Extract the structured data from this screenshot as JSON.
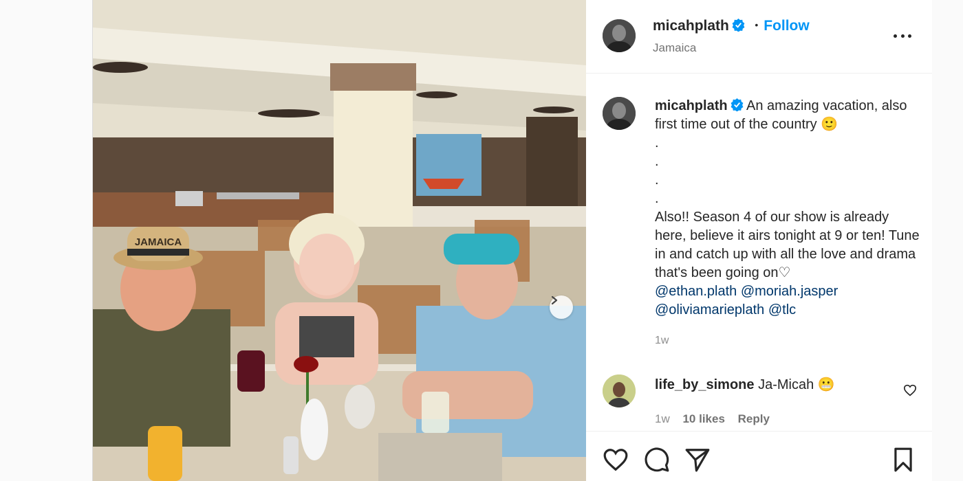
{
  "post": {
    "username": "micahplath",
    "follow_label": "Follow",
    "separator": "•",
    "location": "Jamaica"
  },
  "caption": {
    "username": "micahplath",
    "text_line1": "An amazing vacation, also first time out of the country",
    "emoji": "🙂",
    "dots": [
      ".",
      ".",
      ".",
      "."
    ],
    "text_line2": "Also!! Season 4 of our show is already here, believe it airs tonight at 9 or ten! Tune in and catch up with all the love and drama that's been going on",
    "heart_glyph": "♡",
    "mentions": [
      "@ethan.plath",
      "@moriah.jasper",
      "@oliviamarieplath",
      "@tlc"
    ],
    "time": "1w"
  },
  "comment": {
    "username": "life_by_simone",
    "text": "Ja-Micah",
    "emoji": "😬",
    "time": "1w",
    "likes": "10 likes",
    "reply_label": "Reply"
  },
  "media": {
    "hat_text": "JAMAICA"
  },
  "colors": {
    "link_blue": "#0095f6",
    "mention_blue": "#00376b",
    "verified_blue": "#0095f6"
  },
  "icons": [
    "verified-icon",
    "more-icon",
    "chevron-right-icon",
    "heart-icon",
    "comment-icon",
    "share-icon",
    "bookmark-icon",
    "comment-like-icon"
  ]
}
